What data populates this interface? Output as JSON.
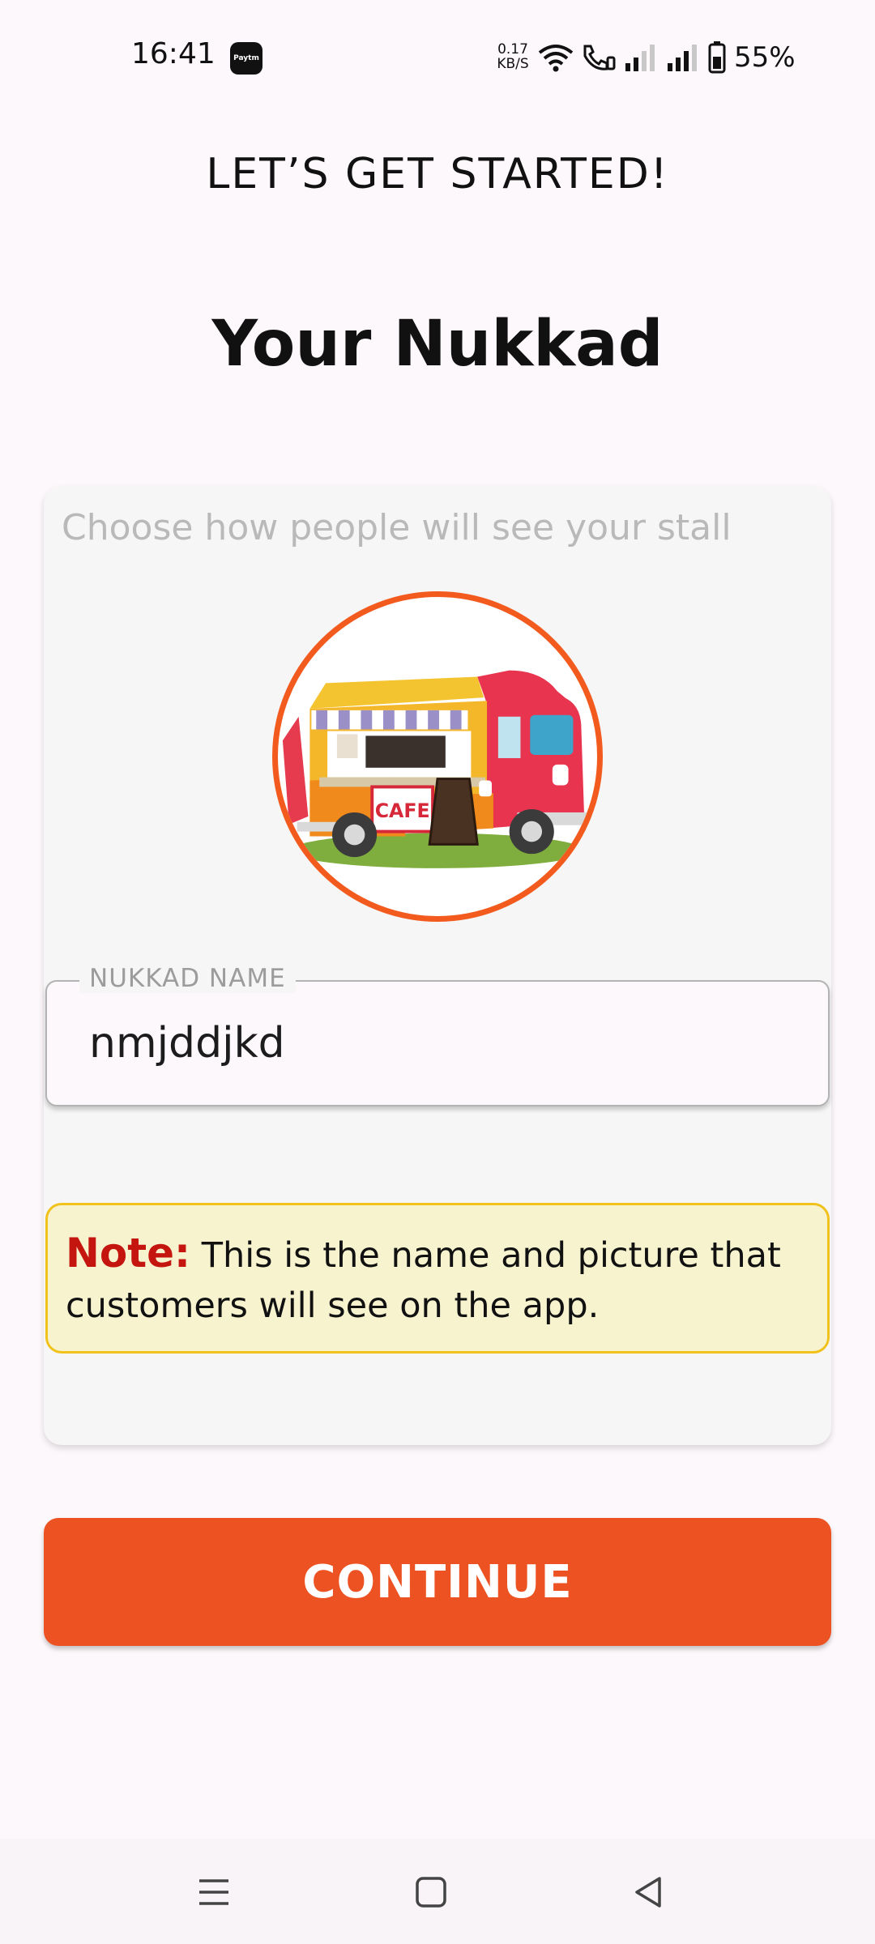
{
  "status_bar": {
    "time": "16:41",
    "app_badge": "Paytm",
    "net_speed_value": "0.17",
    "net_speed_unit": "KB/S",
    "battery": "55%",
    "icons": [
      "paytm-icon",
      "wifi-icon",
      "wifi-calling-icon",
      "signal-icon",
      "signal-icon",
      "battery-icon"
    ]
  },
  "header": {
    "subtitle": "LET’S GET STARTED!",
    "title": "Your Nukkad"
  },
  "card": {
    "hint": "Choose how people will see your stall",
    "avatar_icon": "food-truck-icon",
    "name_field": {
      "label": "NUKKAD NAME",
      "value": "nmjddjkd"
    },
    "note": {
      "label": "Note:",
      "text": "This is the name and picture that customers will see on the app."
    }
  },
  "continue_label": "CONTINUE",
  "nav": {
    "icons": [
      "menu-icon",
      "home-icon",
      "back-icon"
    ]
  },
  "colors": {
    "accent": "#ec5222",
    "note_background": "#f7f3cf",
    "note_border": "#f1c21b",
    "note_label": "#c4150e"
  }
}
